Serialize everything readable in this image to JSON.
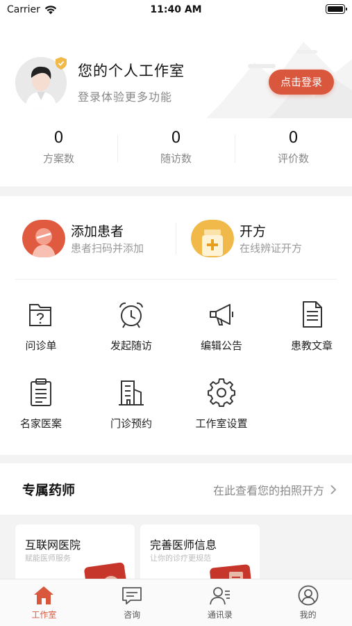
{
  "status_bar": {
    "carrier": "Carrier",
    "time": "11:40 AM"
  },
  "profile": {
    "title": "您的个人工作室",
    "subtitle": "登录体验更多功能",
    "login_button": "点击登录"
  },
  "stats": [
    {
      "value": "0",
      "label": "方案数"
    },
    {
      "value": "0",
      "label": "随访数"
    },
    {
      "value": "0",
      "label": "评价数"
    }
  ],
  "quick_actions": [
    {
      "title": "添加患者",
      "subtitle": "患者扫码并添加",
      "icon": "add-patient-icon"
    },
    {
      "title": "开方",
      "subtitle": "在线辨证开方",
      "icon": "prescription-icon"
    }
  ],
  "tools": [
    {
      "label": "问诊单",
      "icon": "inquiry-form-icon"
    },
    {
      "label": "发起随访",
      "icon": "alarm-clock-icon"
    },
    {
      "label": "编辑公告",
      "icon": "megaphone-icon"
    },
    {
      "label": "患教文章",
      "icon": "article-icon"
    },
    {
      "label": "名家医案",
      "icon": "clipboard-icon"
    },
    {
      "label": "门诊预约",
      "icon": "building-icon"
    },
    {
      "label": "工作室设置",
      "icon": "gear-icon"
    }
  ],
  "pharmacist": {
    "title": "专属药师",
    "link": "在此查看您的拍照开方"
  },
  "cards": [
    {
      "title": "互联网医院",
      "subtitle": "赋能医师服务"
    },
    {
      "title": "完善医师信息",
      "subtitle": "让你的诊疗更规范"
    }
  ],
  "tabbar": [
    {
      "label": "工作室",
      "icon": "home-icon",
      "active": true
    },
    {
      "label": "咨询",
      "icon": "chat-icon",
      "active": false
    },
    {
      "label": "通讯录",
      "icon": "contacts-icon",
      "active": false
    },
    {
      "label": "我的",
      "icon": "profile-icon",
      "active": false
    }
  ],
  "colors": {
    "accent": "#d9573d",
    "gold": "#f0b94a",
    "text": "#222222",
    "muted": "#888888"
  }
}
